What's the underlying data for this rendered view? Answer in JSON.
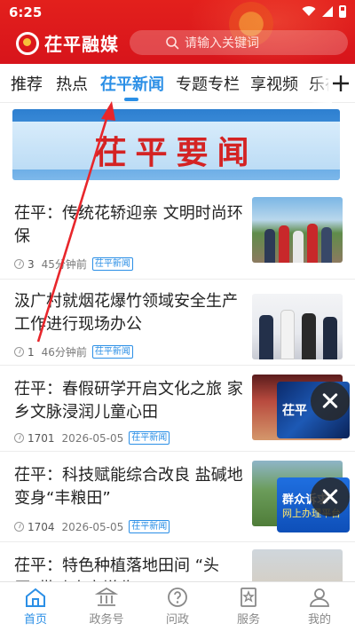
{
  "status_bar": {
    "time": "6:25"
  },
  "header": {
    "logo_text": "茌平融媒",
    "search_placeholder": "请输入关键词"
  },
  "tabs": [
    {
      "label": "推荐"
    },
    {
      "label": "热点"
    },
    {
      "label": "茌平新闻",
      "active": true
    },
    {
      "label": "专题专栏"
    },
    {
      "label": "享视频"
    },
    {
      "label": "乐在"
    }
  ],
  "banner": {
    "text": "茌平要闻"
  },
  "articles": [
    {
      "title": "茌平：传统花轿迎亲  文明时尚环保",
      "count": "3",
      "time": "45分钟前",
      "tag": "茌平新闻"
    },
    {
      "title": "汲广村就烟花爆竹领域安全生产工作进行现场办公",
      "count": "1",
      "time": "46分钟前",
      "tag": "茌平新闻"
    },
    {
      "title": "茌平：春假研学开启文化之旅  家乡文脉浸润儿童心田",
      "count": "1701",
      "time": "2026-05-05",
      "tag": "茌平新闻"
    },
    {
      "title": "茌平：科技赋能综合改良  盐碱地变身“丰粮田”",
      "count": "1704",
      "time": "2026-05-05",
      "tag": "茌平新闻"
    },
    {
      "title": "茌平：特色种植落地田间 “头雁”带动农户增收"
    }
  ],
  "floating": {
    "video_title": "茌平",
    "complaint_line1": "群众诉求",
    "complaint_line2": "网上办理平台"
  },
  "bottom_nav": [
    {
      "label": "首页",
      "icon": "home-icon",
      "active": true
    },
    {
      "label": "政务号",
      "icon": "government-building-icon"
    },
    {
      "label": "问政",
      "icon": "question-bubble-icon"
    },
    {
      "label": "服务",
      "icon": "service-star-icon"
    },
    {
      "label": "我的",
      "icon": "user-icon"
    }
  ],
  "colors": {
    "brand_red": "#d7141b",
    "accent_blue": "#2b8fe6"
  }
}
